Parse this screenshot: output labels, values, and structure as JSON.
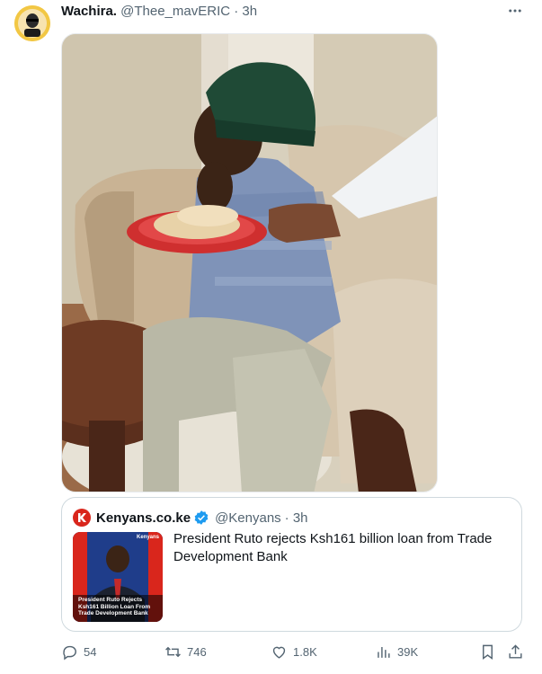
{
  "tweet": {
    "author_name": "Wachira.",
    "author_handle": "@Thee_mavERIC",
    "time": "· 3h"
  },
  "quote": {
    "name": "Kenyans.co.ke",
    "handle": "@Kenyans",
    "time": "· 3h",
    "text": "President Ruto rejects Ksh161 billion loan from Trade Development Bank",
    "thumb_text": "President Ruto Rejects Ksh161 Billion Loan From Trade Development Bank",
    "thumb_brand": "Kenyans"
  },
  "actions": {
    "replies": "54",
    "reposts": "746",
    "likes": "1.8K",
    "views": "39K"
  },
  "colors": {
    "text": "#0f1419",
    "secondary": "#536471",
    "verified": "#1d9bf0",
    "brand_red": "#d9261c"
  },
  "icons": [
    "more-icon",
    "verified-icon",
    "reply-icon",
    "repost-icon",
    "like-icon",
    "views-icon",
    "bookmark-icon",
    "share-icon"
  ]
}
